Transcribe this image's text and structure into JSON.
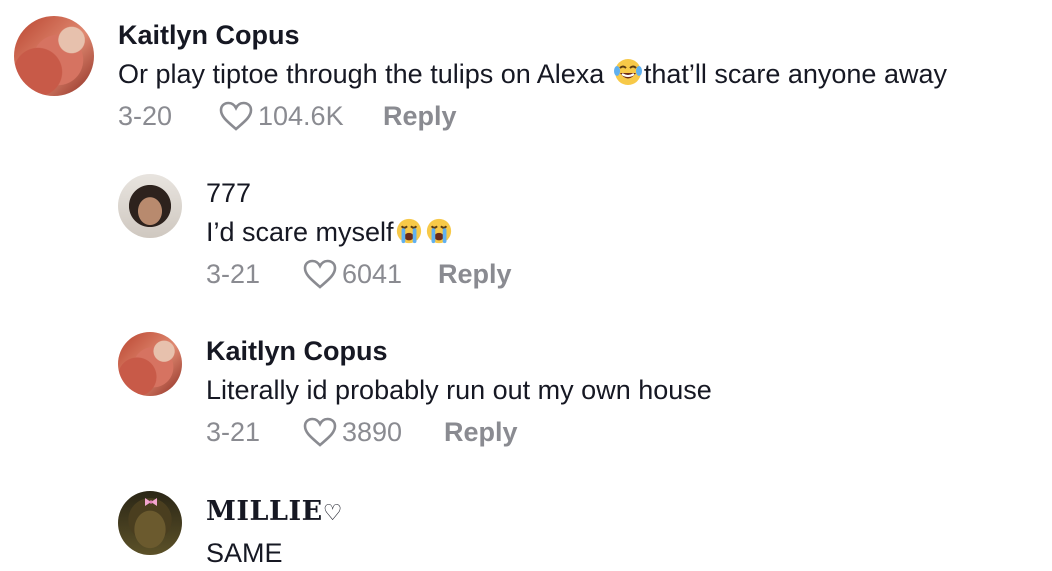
{
  "comments": [
    {
      "name": "Kaitlyn Copus",
      "text_before": "Or play tiptoe through the tulips on Alexa ",
      "emoji": "laughing-tears",
      "text_after": "that’ll scare anyone away",
      "date": "3-20",
      "likes": "104.6K",
      "reply_label": "Reply"
    },
    {
      "name": "777",
      "text_before": "I’d scare myself",
      "emoji": "loudly-crying x2",
      "text_after": "",
      "date": "3-21",
      "likes": "6041",
      "reply_label": "Reply"
    },
    {
      "name": "Kaitlyn Copus",
      "text_before": "Literally id probably run out my own house",
      "date": "3-21",
      "likes": "3890",
      "reply_label": "Reply"
    },
    {
      "name": "MILLIE",
      "name_symbol": "♡",
      "text_before": "SAME"
    }
  ],
  "colors": {
    "primary_text": "#161823",
    "secondary_text": "#8a8b91"
  }
}
